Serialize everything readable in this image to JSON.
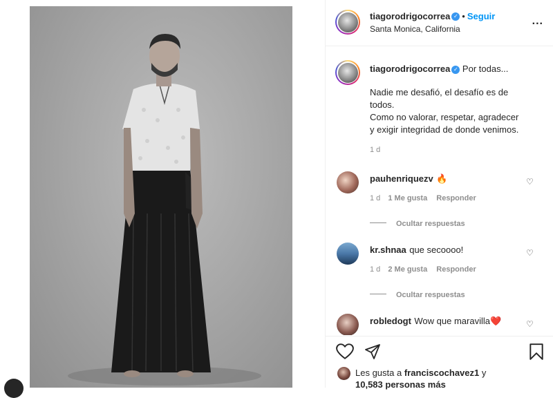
{
  "post": {
    "username": "tiagorodrigocorrea",
    "follow_label": "Seguir",
    "separator": "•",
    "location": "Santa Monica, California",
    "more_label": "..."
  },
  "caption": {
    "username": "tiagorodrigocorrea",
    "headline": "Por todas...",
    "line1": "Nadie me desafió, el desafío es de",
    "line2": "todos.",
    "line3": "Como no valorar, respetar, agradecer",
    "line4": "y exigir integridad de donde venimos.",
    "time": "1 d"
  },
  "comments": [
    {
      "username": "pauhenriquezv",
      "text": "🔥",
      "time": "1 d",
      "likes": "1 Me gusta",
      "reply": "Responder",
      "hide": "Ocultar respuestas"
    },
    {
      "username": "kr.shnaa",
      "text": "que secoooo!",
      "time": "1 d",
      "likes": "2 Me gusta",
      "reply": "Responder",
      "hide": "Ocultar respuestas"
    },
    {
      "username": "robledogt",
      "text": "Wow que maravilla❤️"
    }
  ],
  "likes": {
    "prefix": "Les gusta a",
    "user": "franciscochavez1",
    "joiner": "y",
    "count": "10,583 personas más"
  },
  "colors": {
    "accent": "#0095f6",
    "verified": "#3897f0",
    "text": "#262626",
    "muted": "#8e8e8e"
  }
}
